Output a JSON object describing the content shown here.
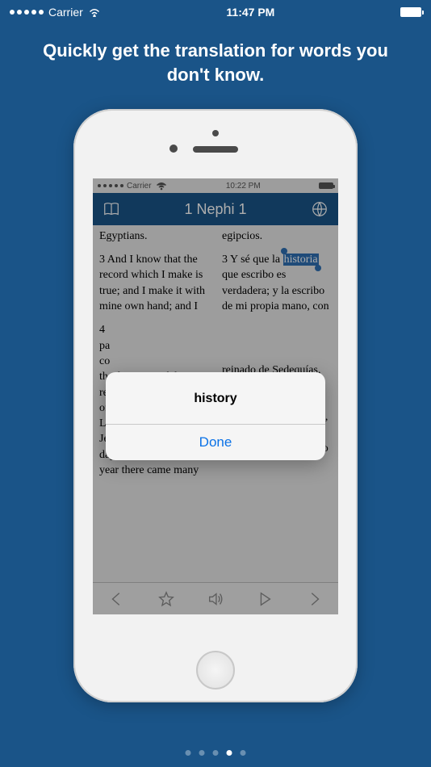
{
  "outer_status": {
    "carrier": "Carrier",
    "time": "11:47 PM"
  },
  "instruction": "Quickly get the translation for words you don't know.",
  "inner_status": {
    "carrier": "Carrier",
    "time": "10:22 PM"
  },
  "navbar": {
    "title": "1 Nephi 1"
  },
  "content": {
    "left": {
      "partial_top": "and the language of the Egyptians.",
      "verse3": "3 And I know that the record which I make is true; and I make it with mine own hand; and I ",
      "verse4_partial": "4 ",
      "verse4_rest": "the first year of the reign of Zedekiah, king of Judah, (my father, Lehi, having dwelt at Jerusalem in all his days); and in that same year there came many"
    },
    "right": {
      "partial_top": "y el idioma de los egipcios.",
      "verse3_before": "3 Y sé que la ",
      "verse3_highlight": "historia",
      "verse3_after": " que escribo es verdadera; y la escribo de mi propia mano, con ",
      "verse4": "reinado de Sedequías, rey de Judá (mi padre Lehi había morado en Jerusalén toda su vida), llegaron muchos profetas ese mismo año"
    }
  },
  "alert": {
    "title": "history",
    "done": "Done"
  },
  "page_indicator": {
    "count": 5,
    "active": 3
  }
}
